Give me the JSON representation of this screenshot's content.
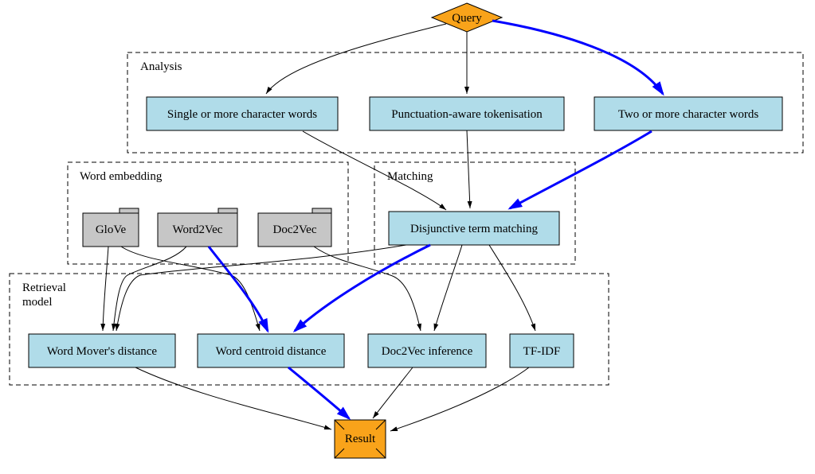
{
  "start": {
    "label": "Query"
  },
  "end": {
    "label": "Result"
  },
  "clusters": {
    "analysis": {
      "label": "Analysis"
    },
    "embedding": {
      "label": "Word embedding"
    },
    "matching": {
      "label": "Matching"
    },
    "retrieval_l1": "Retrieval",
    "retrieval_l2": "model"
  },
  "nodes": {
    "analysis1": "Single or more character words",
    "analysis2": "Punctuation-aware tokenisation",
    "analysis3": "Two or more character words",
    "emb1": "GloVe",
    "emb2": "Word2Vec",
    "emb3": "Doc2Vec",
    "matching1": "Disjunctive term matching",
    "rm1": "Word Mover's distance",
    "rm2": "Word centroid distance",
    "rm3": "Doc2Vec inference",
    "rm4": "TF-IDF"
  }
}
